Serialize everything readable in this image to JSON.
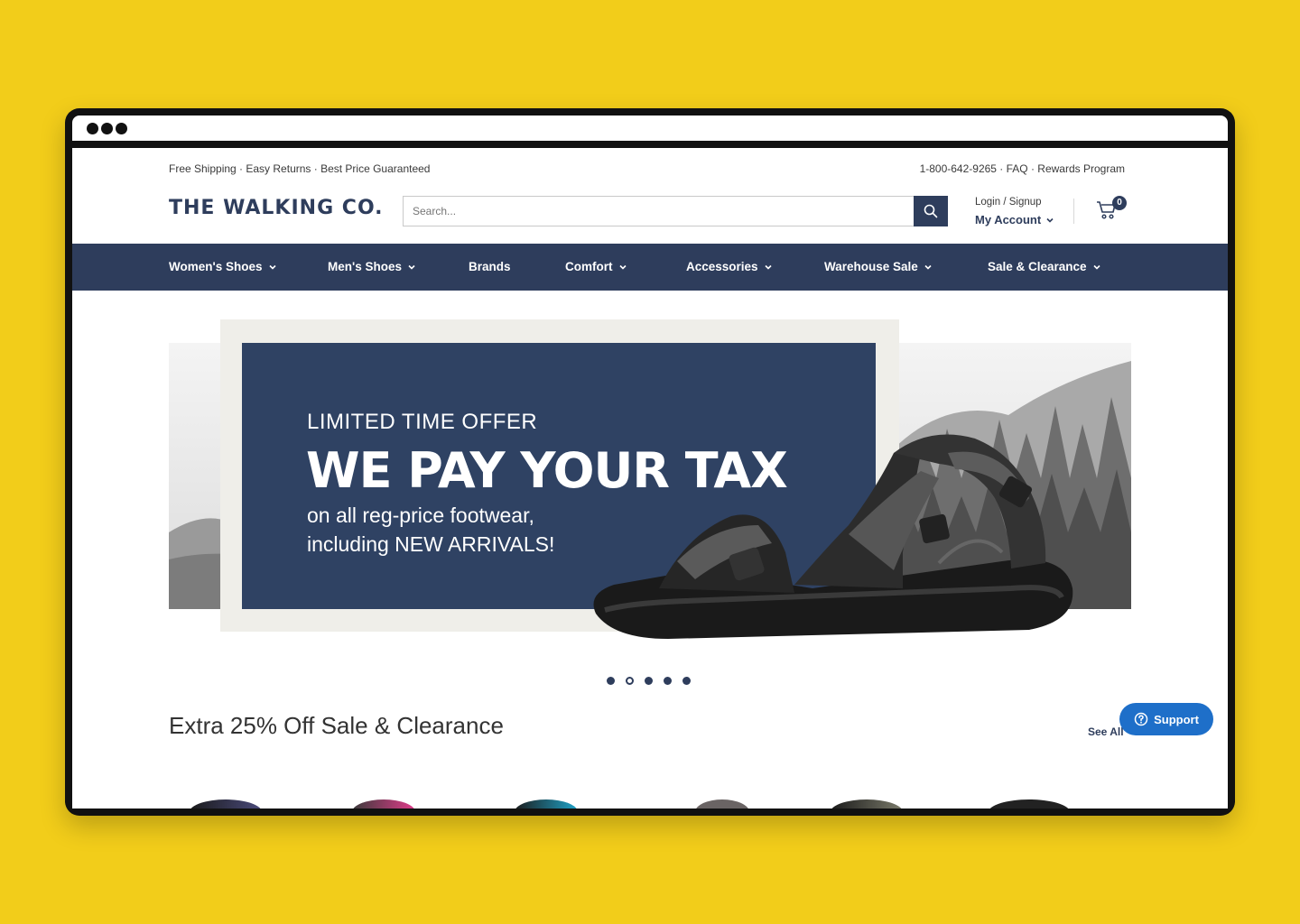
{
  "utility": {
    "left": "Free Shipping · Easy Returns · Best Price Guaranteed",
    "right": "1-800-642-9265 · FAQ · Rewards Program"
  },
  "header": {
    "logo": "THE WALKING CO.",
    "search_placeholder": "Search...",
    "login": "Login / Signup",
    "my_account": "My Account",
    "cart_count": "0"
  },
  "nav": {
    "items": [
      {
        "label": "Women's Shoes",
        "has_dropdown": true
      },
      {
        "label": "Men's Shoes",
        "has_dropdown": true
      },
      {
        "label": "Brands",
        "has_dropdown": false
      },
      {
        "label": "Comfort",
        "has_dropdown": true
      },
      {
        "label": "Accessories",
        "has_dropdown": true
      },
      {
        "label": "Warehouse Sale",
        "has_dropdown": true
      },
      {
        "label": "Sale & Clearance",
        "has_dropdown": true
      }
    ]
  },
  "hero": {
    "kicker": "LIMITED TIME OFFER",
    "title": "WE PAY YOUR TAX",
    "line1": "on all reg-price footwear,",
    "line2": "including NEW ARRIVALS!",
    "slides_total": 5,
    "active_slide": 2
  },
  "section": {
    "title": "Extra 25% Off Sale & Clearance",
    "see_all": "See All"
  },
  "support": {
    "label": "Support"
  },
  "colors": {
    "background": "#F2CD1A",
    "brand_navy": "#2e3d5c",
    "support_blue": "#1e6fc9"
  }
}
